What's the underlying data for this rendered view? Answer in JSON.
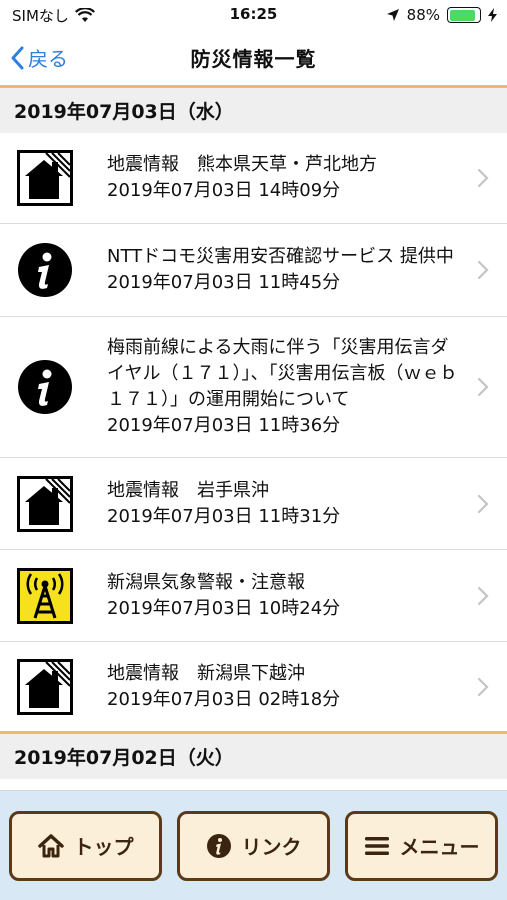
{
  "status_bar": {
    "carrier": "SIMなし",
    "time": "16:25",
    "battery_percent": "88%",
    "battery_level": 0.88
  },
  "nav": {
    "back_label": "戻る",
    "title": "防災情報一覧"
  },
  "sections": [
    {
      "date": "2019年07月03日（水）",
      "items": [
        {
          "icon": "house-earthquake-icon",
          "title": "地震情報　熊本県天草・芦北地方",
          "timestamp": "2019年07月03日 14時09分"
        },
        {
          "icon": "info-icon",
          "title": "NTTドコモ災害用安否確認サービス 提供中",
          "timestamp": "2019年07月03日 11時45分"
        },
        {
          "icon": "info-icon",
          "title": "梅雨前線による大雨に伴う「災害用伝言ダイヤル（１７１）」、「災害用伝言板（ｗｅｂ１７１）」の運用開始について",
          "timestamp": "2019年07月03日 11時36分"
        },
        {
          "icon": "house-earthquake-icon",
          "title": "地震情報　岩手県沖",
          "timestamp": "2019年07月03日 11時31分"
        },
        {
          "icon": "broadcast-tower-icon",
          "title": "新潟県気象警報・注意報",
          "timestamp": "2019年07月03日 10時24分"
        },
        {
          "icon": "house-earthquake-icon",
          "title": "地震情報　新潟県下越沖",
          "timestamp": "2019年07月03日 02時18分"
        }
      ]
    },
    {
      "date": "2019年07月02日（火）",
      "items": []
    }
  ],
  "bottom_bar": {
    "top_label": "トップ",
    "link_label": "リンク",
    "menu_label": "メニュー"
  },
  "colors": {
    "accent": "#2f7fde",
    "divider": "#f2b868",
    "warning_icon_bg": "#f5e11d",
    "tab_bg": "#fbefd9",
    "tab_border": "#5a3a17",
    "bottom_bar_bg": "#d9e8f5"
  }
}
